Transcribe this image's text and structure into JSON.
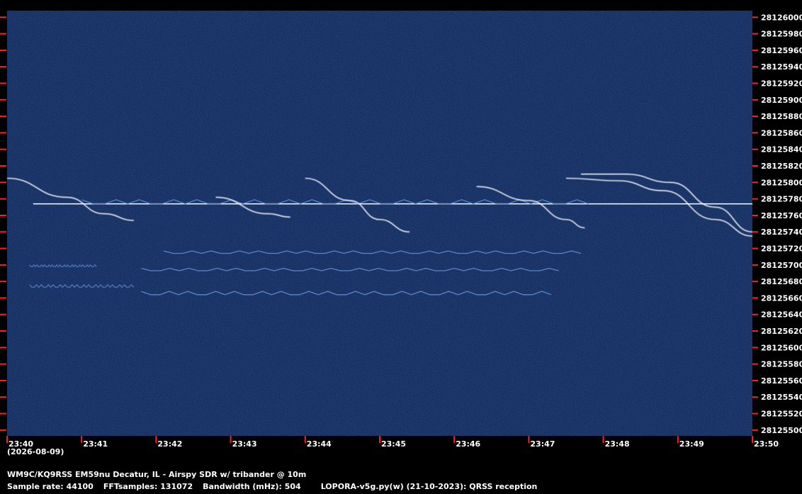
{
  "colors": {
    "background": "#000000",
    "plot_bg": "#0b1f4e",
    "signal": "#ffffff",
    "signal_dim": "#5f8fd6",
    "tick": "#ff2020",
    "text": "#ffffff"
  },
  "date_label": "(2026-08-09)",
  "footer": {
    "station": "WM9C/KQ9RSS EM59nu Decatur, IL - Airspy SDR w/ tribander @ 10m",
    "sample_rate": "Sample rate: 44100",
    "fft_samples": "FFTsamples: 131072",
    "bandwidth": "Bandwidth (mHz): 504",
    "software": "LOPORA-v5g.py(w) (21-10-2023): QRSS reception"
  },
  "chart_data": {
    "type": "heatmap",
    "x_ticks": [
      "23:40",
      "23:41",
      "23:42",
      "23:43",
      "23:44",
      "23:45",
      "23:46",
      "23:47",
      "23:48",
      "23:49",
      "23:50"
    ],
    "y_ticks": [
      28126000,
      28125980,
      28125960,
      28125940,
      28125920,
      28125900,
      28125880,
      28125860,
      28125840,
      28125820,
      28125800,
      28125780,
      28125760,
      28125740,
      28125720,
      28125700,
      28125680,
      28125660,
      28125640,
      28125620,
      28125600,
      28125580,
      28125560,
      28125540,
      28125520,
      28125500
    ],
    "xlim": [
      0,
      10
    ],
    "ylim": [
      28125493,
      28126008
    ],
    "signals": [
      {
        "kind": "steady-carrier",
        "t": [
          0.35,
          10
        ],
        "f": 28125774
      },
      {
        "kind": "fsk-keyed",
        "t": [
          1.0,
          7.8
        ],
        "f_base": 28125774,
        "f_shift": 28125779
      },
      {
        "kind": "fsk-keyed",
        "t": [
          2.1,
          7.7
        ],
        "f_base": 28125714,
        "f_shift": 28125717
      },
      {
        "kind": "fsk-keyed",
        "t": [
          1.8,
          7.4
        ],
        "f_base": 28125693,
        "f_shift": 28125696
      },
      {
        "kind": "fsk-keyed",
        "t": [
          1.8,
          7.3
        ],
        "f_base": 28125664,
        "f_shift": 28125668
      },
      {
        "kind": "drift-sweep",
        "points": [
          [
            0.0,
            28125805
          ],
          [
            0.8,
            28125782
          ],
          [
            1.3,
            28125762
          ],
          [
            1.7,
            28125754
          ]
        ]
      },
      {
        "kind": "drift-sweep",
        "points": [
          [
            2.8,
            28125782
          ],
          [
            3.5,
            28125762
          ],
          [
            3.8,
            28125758
          ]
        ]
      },
      {
        "kind": "drift-sweep",
        "points": [
          [
            4.0,
            28125805
          ],
          [
            4.6,
            28125778
          ],
          [
            5.0,
            28125755
          ],
          [
            5.4,
            28125740
          ]
        ]
      },
      {
        "kind": "drift-sweep",
        "points": [
          [
            6.3,
            28125795
          ],
          [
            7.0,
            28125778
          ],
          [
            7.5,
            28125755
          ],
          [
            7.75,
            28125745
          ]
        ]
      },
      {
        "kind": "drift-sweep",
        "points": [
          [
            7.7,
            28125810
          ],
          [
            8.3,
            28125810
          ],
          [
            8.9,
            28125800
          ],
          [
            9.5,
            28125770
          ],
          [
            10.0,
            28125740
          ]
        ]
      },
      {
        "kind": "drift-sweep",
        "points": [
          [
            7.5,
            28125805
          ],
          [
            8.2,
            28125802
          ],
          [
            8.8,
            28125790
          ],
          [
            9.5,
            28125755
          ],
          [
            10.0,
            28125735
          ]
        ]
      },
      {
        "kind": "fsk-keyed",
        "t": [
          0.3,
          1.7
        ],
        "f_base": 28125673,
        "f_shift": 28125676,
        "dim": true
      },
      {
        "kind": "fsk-keyed",
        "t": [
          0.3,
          1.2
        ],
        "f_base": 28125698,
        "f_shift": 28125700,
        "dim": true
      }
    ]
  }
}
